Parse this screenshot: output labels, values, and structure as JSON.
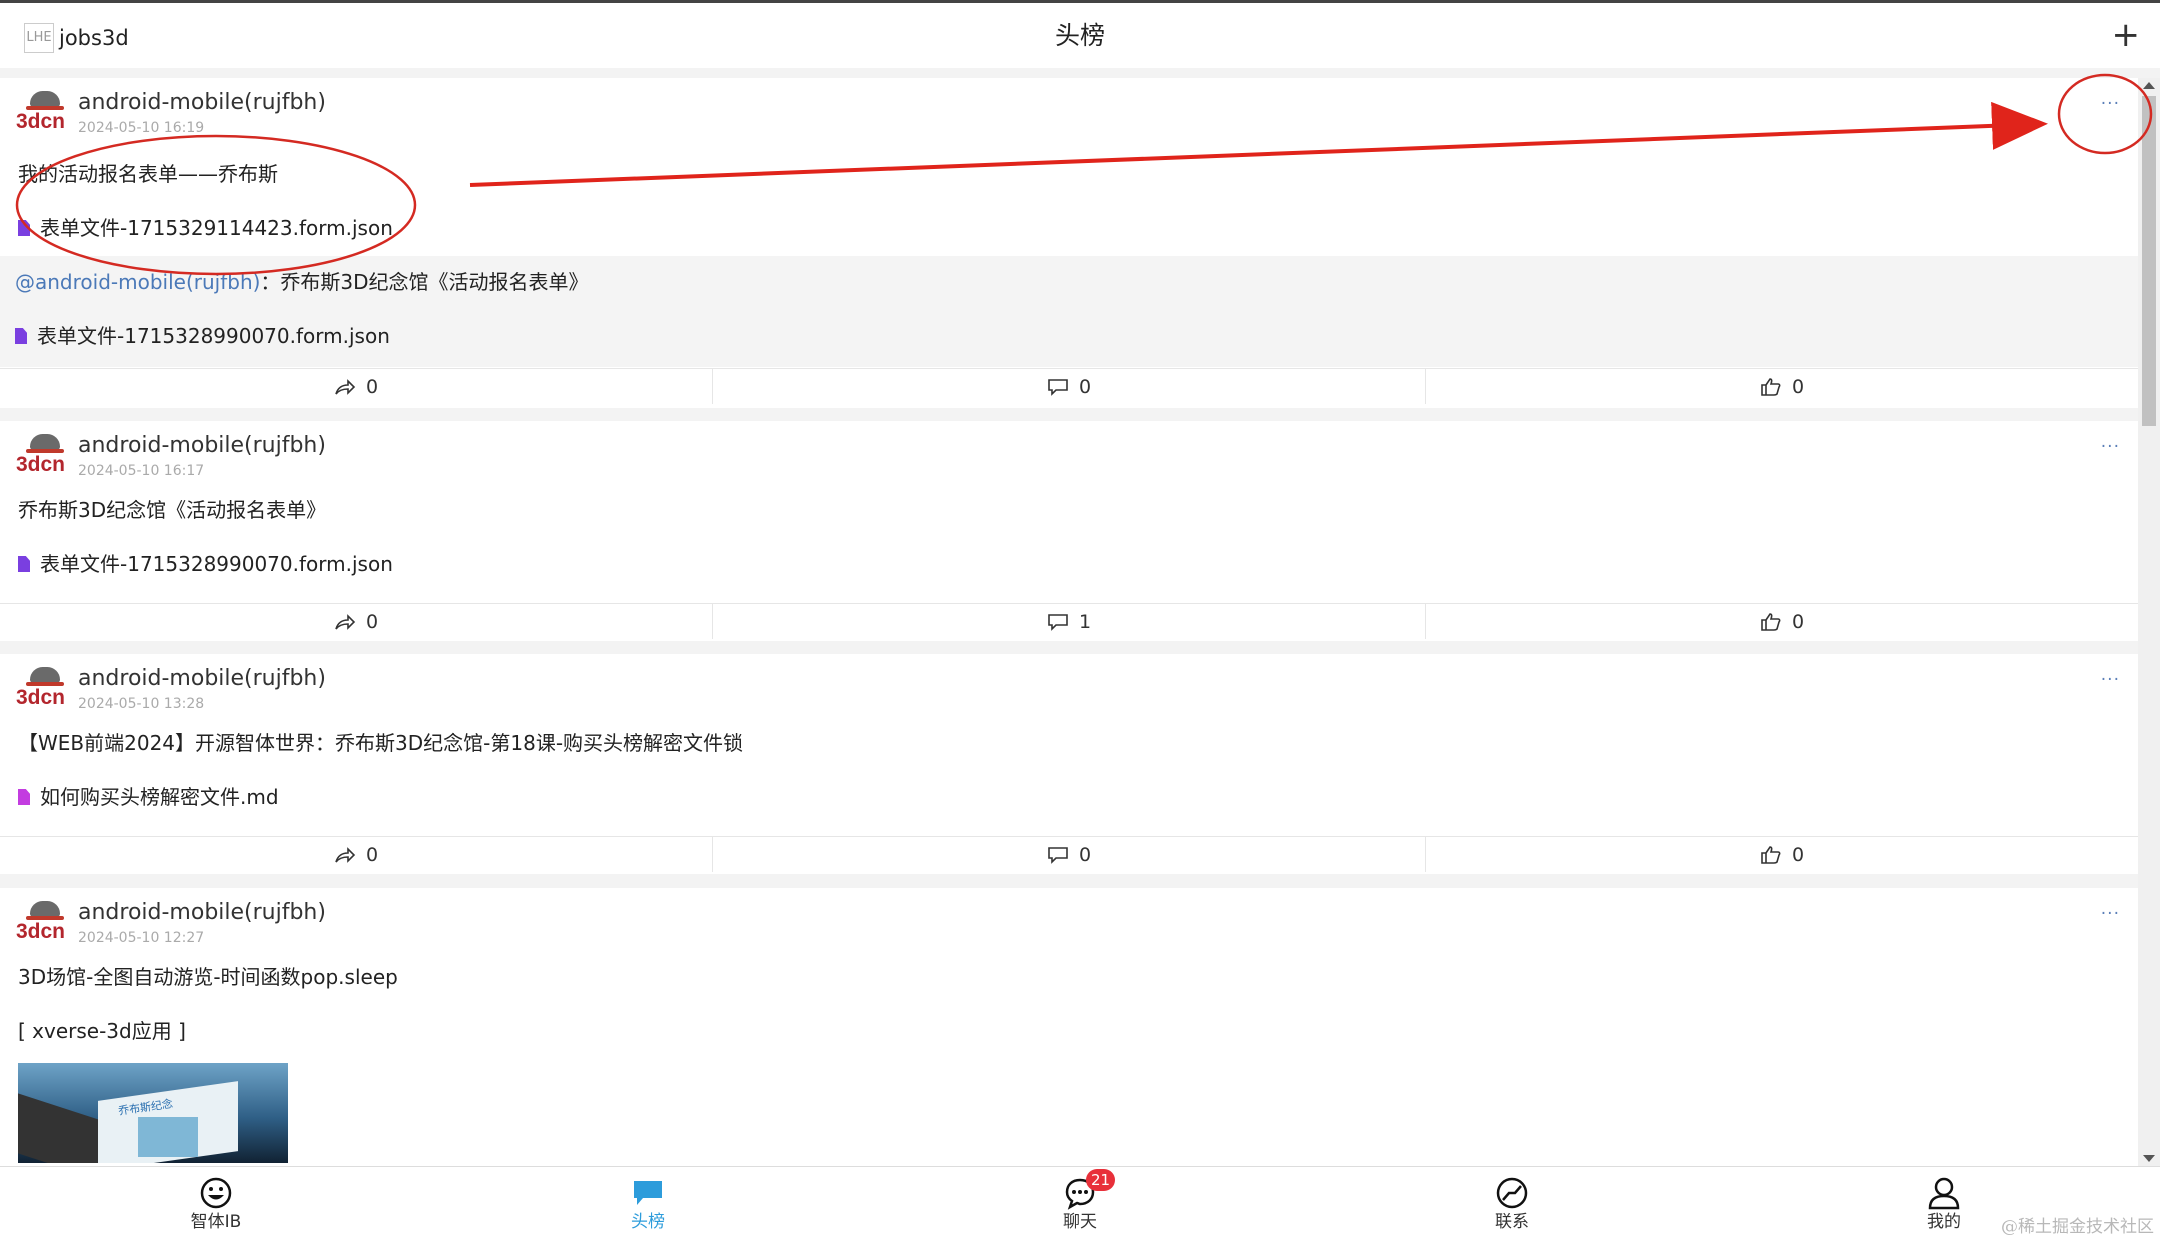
{
  "header": {
    "logo_alt": "LHE",
    "username": "jobs3d",
    "title": "头榜",
    "add_symbol": "+"
  },
  "avatar_brand": "3dcn",
  "posts": [
    {
      "author": "android-mobile(rujfbh)",
      "time": "2024-05-10 16:19",
      "more": "···",
      "text": "我的活动报名表单——乔布斯",
      "file": "表单文件-1715329114423.form.json",
      "quote": {
        "mention": "@android-mobile(rujfbh)",
        "text": "：乔布斯3D纪念馆《活动报名表单》",
        "file": "表单文件-1715328990070.form.json"
      },
      "shares": "0",
      "comments": "0",
      "likes": "0"
    },
    {
      "author": "android-mobile(rujfbh)",
      "time": "2024-05-10 16:17",
      "more": "···",
      "text": "乔布斯3D纪念馆《活动报名表单》",
      "file": "表单文件-1715328990070.form.json",
      "shares": "0",
      "comments": "1",
      "likes": "0"
    },
    {
      "author": "android-mobile(rujfbh)",
      "time": "2024-05-10 13:28",
      "more": "···",
      "text": "【WEB前端2024】开源智体世界：乔布斯3D纪念馆-第18课-购买头榜解密文件锁",
      "file": "如何购买头榜解密文件.md",
      "shares": "0",
      "comments": "0",
      "likes": "0"
    },
    {
      "author": "android-mobile(rujfbh)",
      "time": "2024-05-10 12:27",
      "more": "···",
      "text": "3D场馆-全图自动游览-时间函数pop.sleep",
      "tag": "[ xverse-3d应用 ]",
      "image_text": "乔布斯纪念"
    }
  ],
  "nav": [
    {
      "label": "智体IB",
      "icon": "smile-face-icon"
    },
    {
      "label": "头榜",
      "icon": "chat-bubble-icon",
      "active": true
    },
    {
      "label": "聊天",
      "icon": "chat-dots-icon",
      "badge": "21"
    },
    {
      "label": "联系",
      "icon": "compass-slash-icon"
    },
    {
      "label": "我的",
      "icon": "user-icon"
    }
  ],
  "colors": {
    "accent": "#2d9cdb",
    "mention": "#4b79b8",
    "annotation": "#e0241b",
    "badge": "#e8303a",
    "brand": "#b3262d"
  },
  "watermark": "@稀土掘金技术社区"
}
